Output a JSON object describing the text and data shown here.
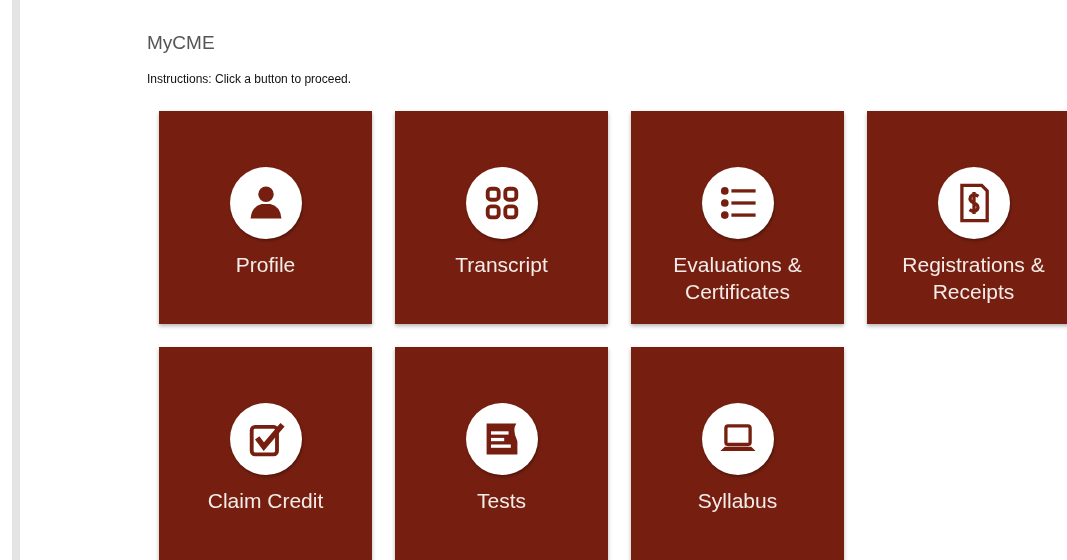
{
  "page": {
    "title": "MyCME",
    "instructions": "Instructions: Click a button to proceed."
  },
  "tiles": [
    {
      "label": "Profile"
    },
    {
      "label": "Transcript"
    },
    {
      "label": "Evaluations & Certificates"
    },
    {
      "label": "Registrations & Receipts"
    },
    {
      "label": "Claim Credit"
    },
    {
      "label": "Tests"
    },
    {
      "label": "Syllabus"
    }
  ]
}
